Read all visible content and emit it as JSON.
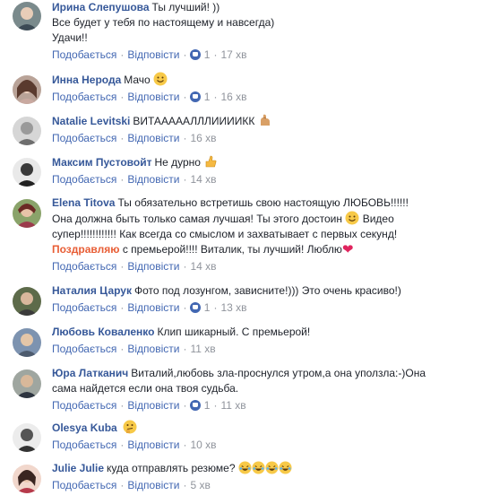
{
  "actions": {
    "like": "Подобається",
    "reply": "Відповісти",
    "sep": "·"
  },
  "comments": [
    {
      "author": "Ирина Слепушова",
      "text_lines": [
        "Ты лучший! ))",
        "Все будет у тебя по настоящему и навсегда)",
        "Удачи!!"
      ],
      "likes": "1",
      "time": "17 хв"
    },
    {
      "author": "Инна Нерода",
      "text": "Мачо",
      "likes": "1",
      "time": "16 хв"
    },
    {
      "author": "Natalie Levitski",
      "text": "ВИТАААААЛЛЛИИИИКК",
      "time": "16 хв"
    },
    {
      "author": "Максим Пустовойт",
      "text": "Не дурно",
      "time": "14 хв"
    },
    {
      "author": "Elena Titova",
      "text_line1": "Ты обязательно встретишь свою настоящую ЛЮБОВЬ!!!!!!",
      "text_line2a": "Она должна быть только самая лучшая! Ты этого достоин",
      "text_line2b": "Видео",
      "text_line3": "супер!!!!!!!!!!!! Как всегда со смыслом и захватывает с первых секунд!",
      "highlight": "Поздравляю",
      "text_line4": "с премьерой!!!! Виталик, ты лучший! Люблю",
      "time": "14 хв"
    },
    {
      "author": "Наталия Царук",
      "text": "Фото под лозунгом, зависните!))) Это очень красиво!)",
      "likes": "1",
      "time": "13 хв"
    },
    {
      "author": "Любовь Коваленко",
      "text": "Клип шикарный. С премьерой!",
      "time": "11 хв"
    },
    {
      "author": "Юра Латканич",
      "text_line1": "Виталий,любовь зла-проснулся утром,а она уползла:-)Она",
      "text_line2": "сама найдется если она твоя судьба.",
      "likes": "1",
      "time": "11 хв"
    },
    {
      "author": "Olesya Kuba",
      "text": "",
      "time": "10 хв"
    },
    {
      "author": "Julie Julie",
      "text": "куда отправлять резюме?",
      "time": "5 хв"
    }
  ],
  "icons": {
    "smile": "smile-emoji-icon",
    "muscle": "flexed-biceps-emoji-icon",
    "thumbs": "thumbs-up-emoji-icon",
    "heart": "red-heart-emoji-icon",
    "thinking": "thinking-face-emoji-icon",
    "laugh": "laughing-tears-emoji-icon",
    "like": "like-reaction-icon"
  },
  "colors": {
    "author": "#365899",
    "action": "#4267b2",
    "meta": "#90949c",
    "highlight": "#e85d35"
  }
}
